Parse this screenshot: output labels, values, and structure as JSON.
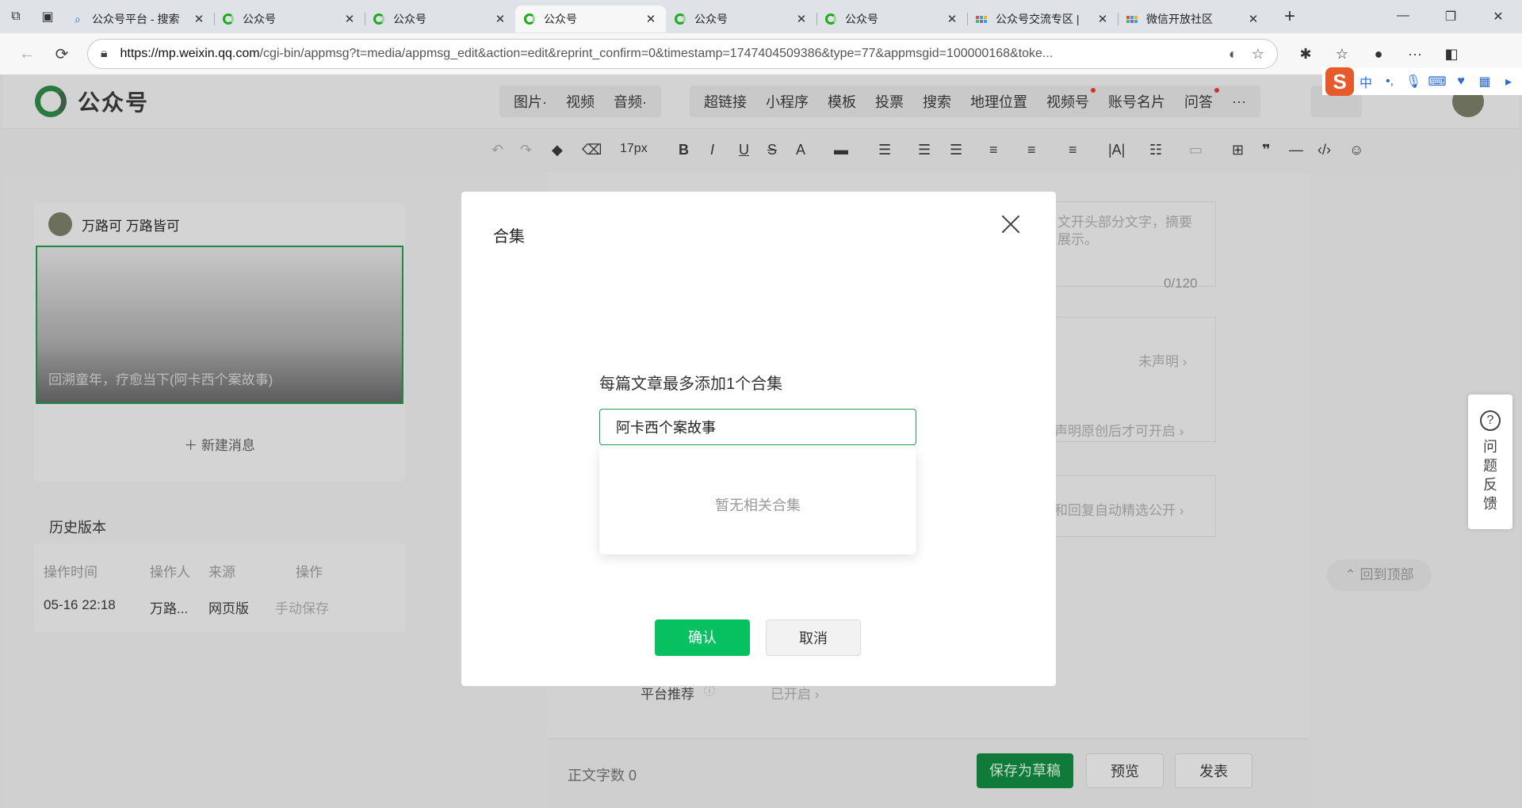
{
  "browser": {
    "tabs": [
      {
        "title": "公众号平台 - 搜索",
        "favicon": "search-icon",
        "active": false
      },
      {
        "title": "公众号",
        "favicon": "wechat-mp-icon",
        "active": false
      },
      {
        "title": "公众号",
        "favicon": "wechat-mp-icon",
        "active": false
      },
      {
        "title": "公众号",
        "favicon": "wechat-mp-icon",
        "active": true
      },
      {
        "title": "公众号",
        "favicon": "wechat-mp-icon",
        "active": false
      },
      {
        "title": "公众号",
        "favicon": "wechat-mp-icon",
        "active": false
      },
      {
        "title": "公众号交流专区 |",
        "favicon": "community-icon",
        "active": false
      },
      {
        "title": "微信开放社区",
        "favicon": "community-icon",
        "active": false
      }
    ],
    "url_host": "https://mp.weixin.qq.com",
    "url_path": "/cgi-bin/appmsg?t=media/appmsg_edit&action=edit&reprint_confirm=0&timestamp=1747404509386&type=77&appmsgid=100000168&toke..."
  },
  "app": {
    "logo_text": "公众号",
    "nav_group1": [
      "图片·",
      "视频",
      "音频·"
    ],
    "nav_group2": [
      {
        "label": "超链接",
        "dot": false
      },
      {
        "label": "小程序",
        "dot": false
      },
      {
        "label": "模板",
        "dot": false
      },
      {
        "label": "投票",
        "dot": false
      },
      {
        "label": "搜索",
        "dot": false
      },
      {
        "label": "地理位置",
        "dot": false
      },
      {
        "label": "视频号",
        "dot": true
      },
      {
        "label": "账号名片",
        "dot": false
      },
      {
        "label": "问答",
        "dot": true
      },
      {
        "label": "···",
        "dot": false
      }
    ],
    "toolbar_font_size": "17px"
  },
  "left": {
    "account_name": "万路可 万路皆可",
    "cover_title": "回溯童年，疗愈当下(阿卡西个案故事)",
    "new_message": "新建消息",
    "history_title": "历史版本",
    "history_headers": [
      "操作时间",
      "操作人",
      "来源",
      "操作"
    ],
    "history_row": [
      "05-16 22:18",
      "万路...",
      "网页版",
      "手动保存"
    ]
  },
  "right": {
    "summary_placeholder_1": "文开头部分文字，摘要",
    "summary_placeholder_2": "展示。",
    "summary_count": "0/120",
    "row_undeclared": "未声明 ›",
    "row_original": "声明原创后才可开启 ›",
    "row_comments": "和回复自动精选公开 ›",
    "platform_label": "平台推荐",
    "platform_value": "已开启 ›"
  },
  "bottom": {
    "word_count_label": "正文字数  0",
    "save_draft": "保存为草稿",
    "preview": "预览",
    "publish": "发表"
  },
  "feedback": {
    "label_chars": [
      "问",
      "题",
      "反",
      "馈"
    ]
  },
  "to_top": "回到顶部",
  "modal": {
    "title": "合集",
    "hint": "每篇文章最多添加1个合集",
    "input_value": "阿卡西个案故事",
    "no_result": "暂无相关合集",
    "confirm": "确认",
    "cancel": "取消"
  },
  "ime": {
    "logo": "S",
    "mode": "中"
  }
}
